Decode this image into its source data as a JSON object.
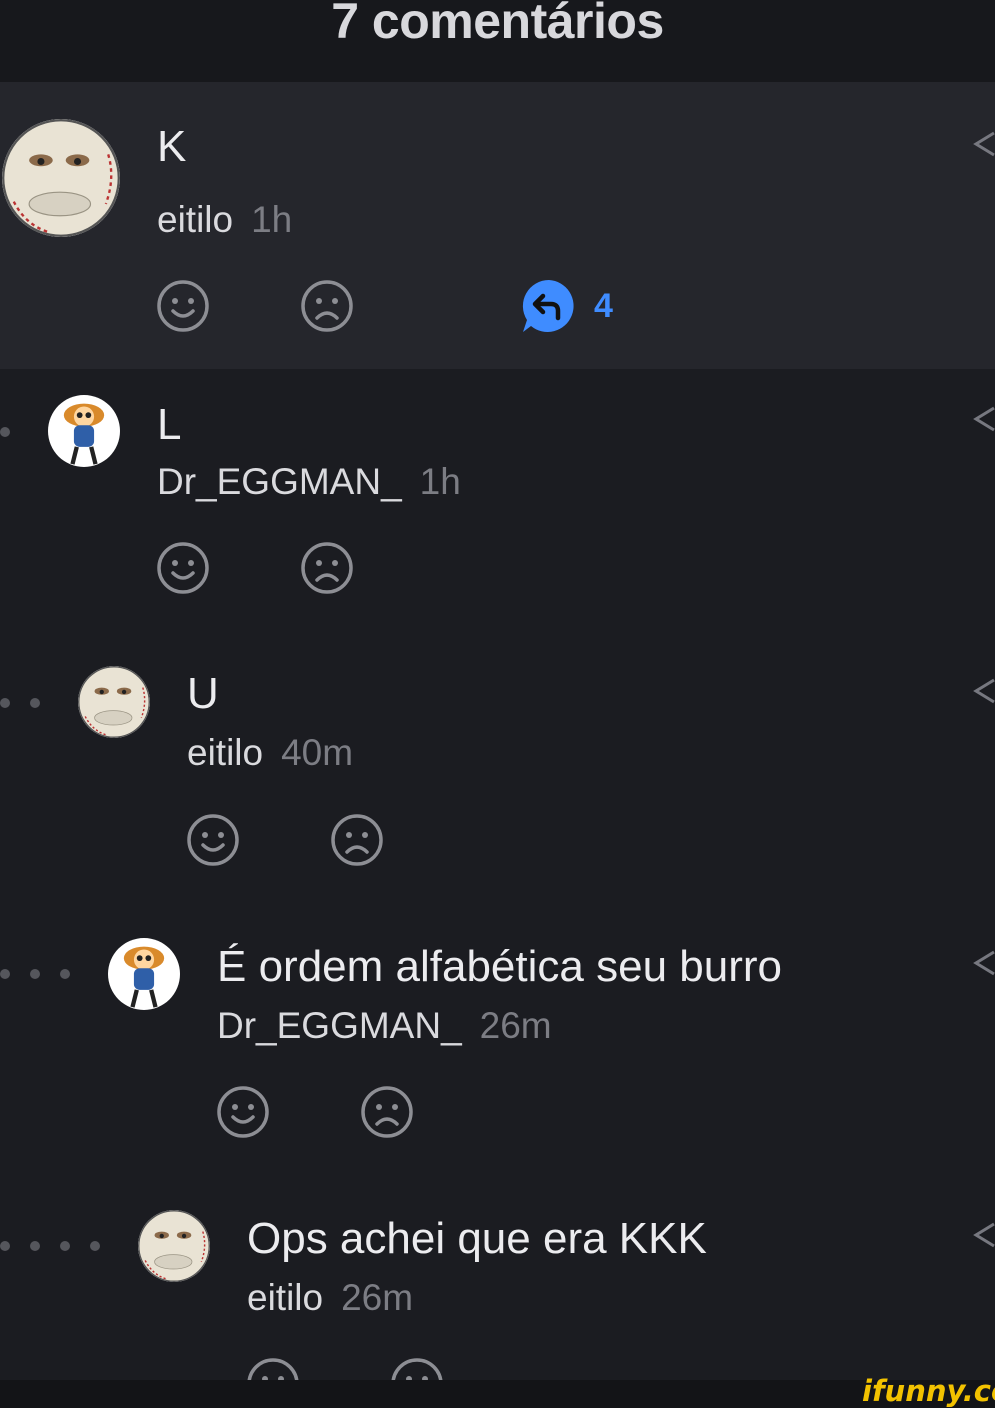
{
  "header": {
    "title": "7 comentários"
  },
  "comments": [
    {
      "text": "K",
      "user": "eitilo",
      "time": "1h",
      "reply_count": "4",
      "depth": 0
    },
    {
      "text": "L",
      "user": "Dr_EGGMAN_",
      "time": "1h",
      "depth": 1
    },
    {
      "text": "U",
      "user": "eitilo",
      "time": "40m",
      "depth": 2
    },
    {
      "text": "É ordem alfabética seu burro",
      "user": "Dr_EGGMAN_",
      "time": "26m",
      "depth": 3
    },
    {
      "text": "Ops achei que era KKK",
      "user": "eitilo",
      "time": "26m",
      "depth": 4
    }
  ],
  "icons": {
    "like": "smile-icon",
    "dislike": "frown-icon",
    "reply": "reply-bubble-icon",
    "share": "share-icon"
  },
  "colors": {
    "accent": "#3f8cff",
    "watermark": "#f2c200"
  },
  "watermark": "ifunny.co"
}
